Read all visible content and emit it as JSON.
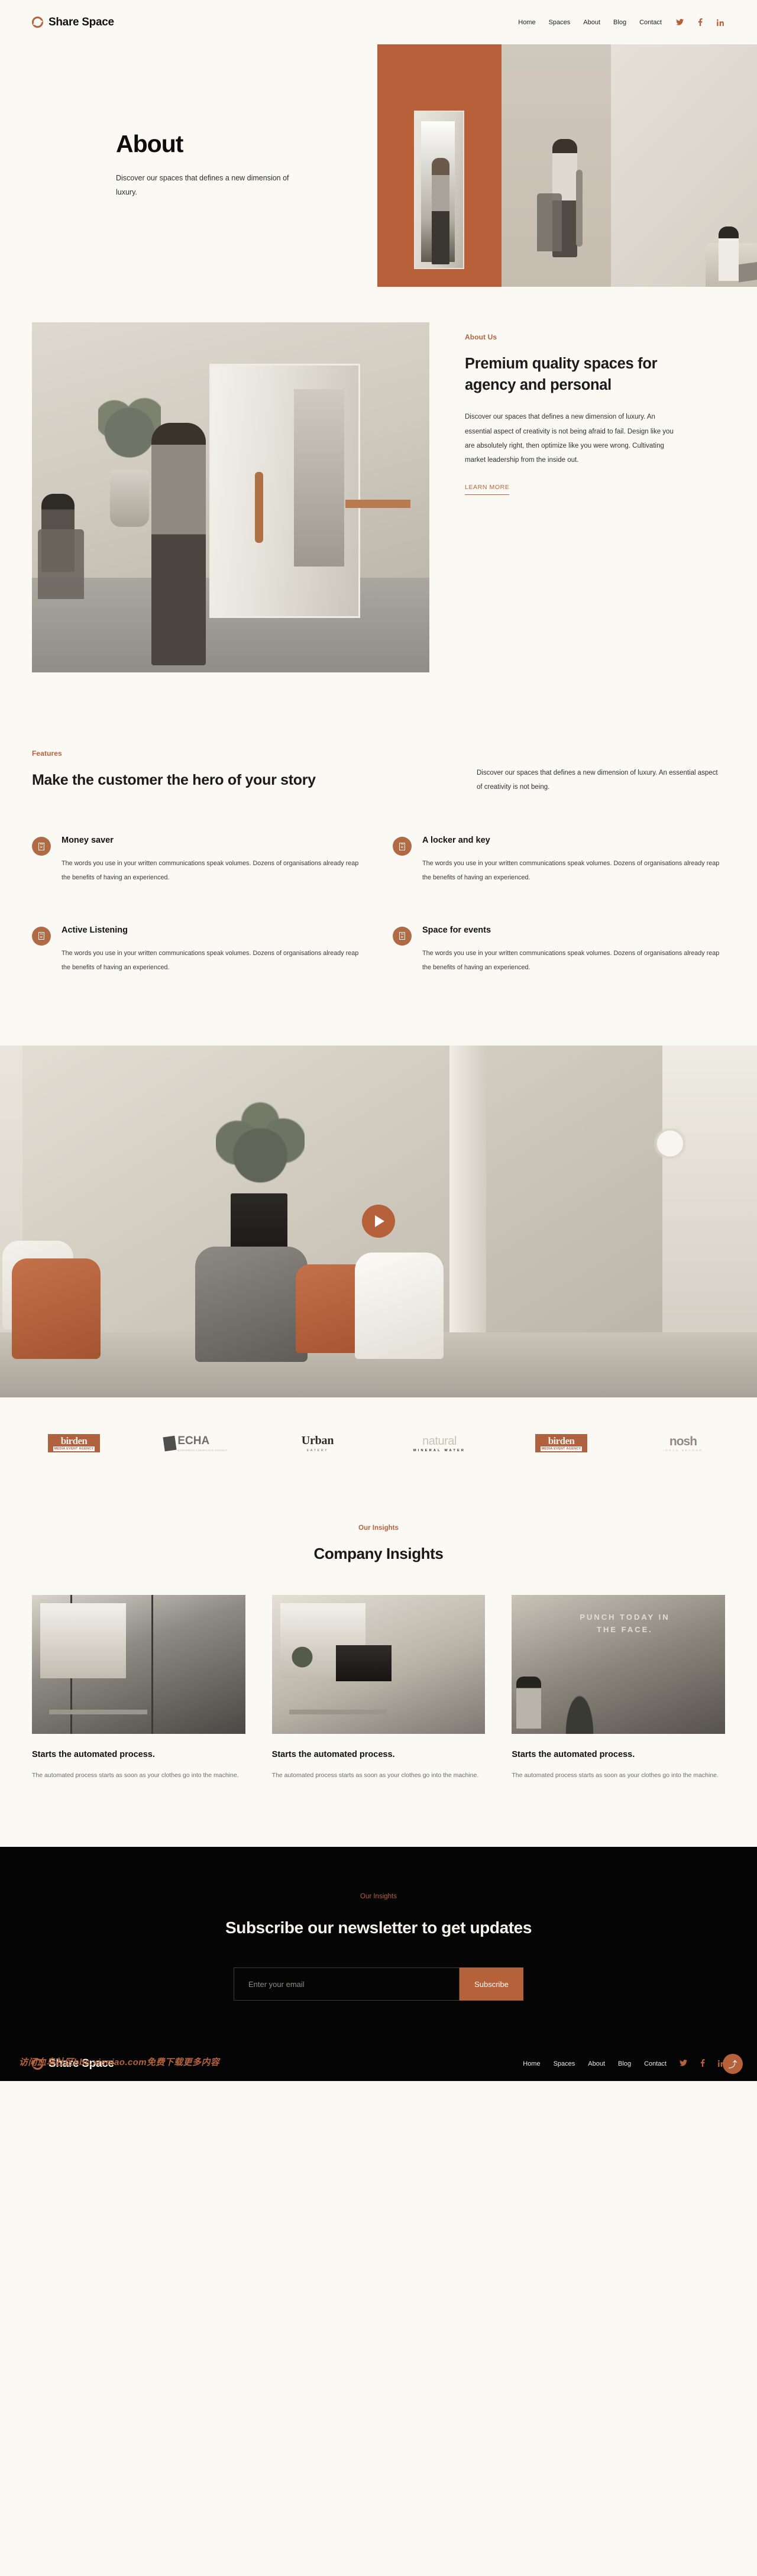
{
  "brand": {
    "name": "Share Space",
    "mark_icon": "ring-logo-icon"
  },
  "nav": {
    "items": [
      {
        "label": "Home"
      },
      {
        "label": "Spaces"
      },
      {
        "label": "About"
      },
      {
        "label": "Blog"
      },
      {
        "label": "Contact"
      }
    ],
    "social": [
      {
        "name": "twitter-icon",
        "glyph": "𝐓"
      },
      {
        "name": "facebook-icon",
        "glyph": "f"
      },
      {
        "name": "linkedin-icon",
        "glyph": "in"
      }
    ]
  },
  "hero": {
    "title": "About",
    "subtitle": "Discover our spaces that defines a new dimension of luxury."
  },
  "about": {
    "eyebrow": "About Us",
    "heading": "Premium quality spaces for agency and personal",
    "paragraph": "Discover our spaces that defines a new dimension of luxury. An essential aspect of creativity is not being afraid to fail. Design like you are absolutely right, then optimize like you were wrong. Cultivating market leadership from the inside out.",
    "cta": "LEARN MORE"
  },
  "features": {
    "eyebrow": "Features",
    "heading": "Make the customer the hero of your story",
    "intro": "Discover our spaces that defines a new dimension of luxury. An essential aspect of creativity is not being.",
    "items": [
      {
        "title": "Money saver",
        "desc": "The words you use in your written communications speak volumes. Dozens of organisations already reap the benefits of having an experienced.",
        "icon": "missing-glyph-box-icon"
      },
      {
        "title": "A locker and key",
        "desc": "The words you use in your written communications speak volumes. Dozens of organisations already reap the benefits of having an experienced.",
        "icon": "missing-glyph-box-icon"
      },
      {
        "title": "Active Listening",
        "desc": "The words you use in your written communications speak volumes. Dozens of organisations already reap the benefits of having an experienced.",
        "icon": "missing-glyph-box-icon"
      },
      {
        "title": "Space for events",
        "desc": "The words you use in your written communications speak volumes. Dozens of organisations already reap the benefits of having an experienced.",
        "icon": "missing-glyph-box-icon"
      }
    ]
  },
  "video": {
    "play_icon": "play-triangle-icon"
  },
  "logos": [
    {
      "name": "birden",
      "word1": "birden",
      "word2": "MEDIA EVENT AGENCY"
    },
    {
      "name": "echa",
      "word1": "ECHA",
      "word2": "EUROPEAN CHEMICALS AGENCY"
    },
    {
      "name": "urban-eatery",
      "word1": "Urban",
      "word2": "EATERY"
    },
    {
      "name": "natural-mineral-water",
      "word1": "natural",
      "word2": "MINERAL WATER"
    },
    {
      "name": "birden-2",
      "word1": "birden",
      "word2": "MEDIA EVENT AGENCY"
    },
    {
      "name": "nosh",
      "word1": "nosh",
      "word2": "IDEAS BEYOND"
    }
  ],
  "insights": {
    "eyebrow": "Our Insights",
    "heading": "Company Insights",
    "cards": [
      {
        "title": "Starts the automated process.",
        "desc": "The automated process starts as soon as your clothes go into the machine."
      },
      {
        "title": "Starts the automated process.",
        "desc": "The automated process starts as soon as your clothes go into the machine."
      },
      {
        "title": "Starts the automated process.",
        "desc": "The automated process starts as soon as your clothes go into the machine.",
        "image_overlay_text": "PUNCH TODAY IN THE FACE."
      }
    ]
  },
  "newsletter": {
    "eyebrow": "Our Insights",
    "heading": "Subscribe our newsletter to get updates",
    "email_placeholder": "Enter your email",
    "email_value": "",
    "button": "Subscribe"
  },
  "footer": {
    "brand": "Share Space",
    "items": [
      {
        "label": "Home"
      },
      {
        "label": "Spaces"
      },
      {
        "label": "About"
      },
      {
        "label": "Blog"
      },
      {
        "label": "Contact"
      }
    ],
    "social": [
      {
        "name": "twitter-icon",
        "glyph": "𝐓"
      },
      {
        "name": "facebook-icon",
        "glyph": "f"
      },
      {
        "name": "linkedin-icon",
        "glyph": "in"
      }
    ]
  },
  "watermark": {
    "text": "访问血鸟社区bbs.xieniao.com免费下载更多内容"
  },
  "fab": {
    "glyph": "⤴",
    "name": "scroll-to-top-button"
  },
  "colors": {
    "accent": "#b5623c",
    "bg": "#fbf9f4",
    "dark": "#050505",
    "text": "#1a1a1a"
  }
}
